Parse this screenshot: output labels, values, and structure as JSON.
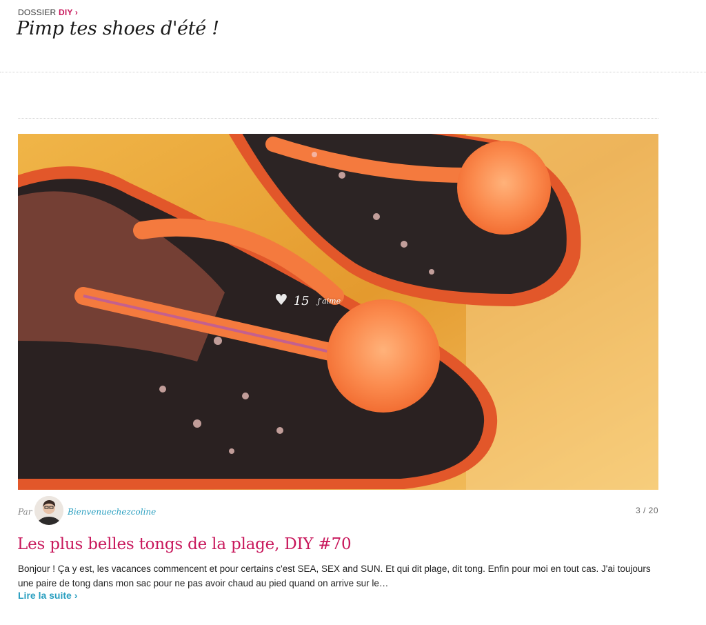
{
  "dossier": {
    "prefix": "DOSSIER",
    "tag": "DIY ›"
  },
  "page_title": "Pimp tes shoes d'été !",
  "post": {
    "likes": {
      "count": "15",
      "label": "j'aime"
    },
    "meta": {
      "by": "Par",
      "author": "Bienvenuechezcoline",
      "pager": "3 / 20"
    },
    "title": "Les plus belles tongs de la plage, DIY #70",
    "excerpt": "Bonjour ! Ça y est, les vacances commencent et pour certains c'est SEA, SEX and SUN. Et qui dit plage, dit tong. Enfin pour moi en tout cas. J'ai toujours une paire de tong dans mon sac pour ne pas avoir chaud au pied quand on arrive sur le…",
    "read_more": "Lire la suite ›"
  },
  "icons": {
    "heart": "heart-icon",
    "avatar": "user-avatar"
  },
  "colors": {
    "accent": "#c8175b",
    "link": "#2a9fc0"
  }
}
